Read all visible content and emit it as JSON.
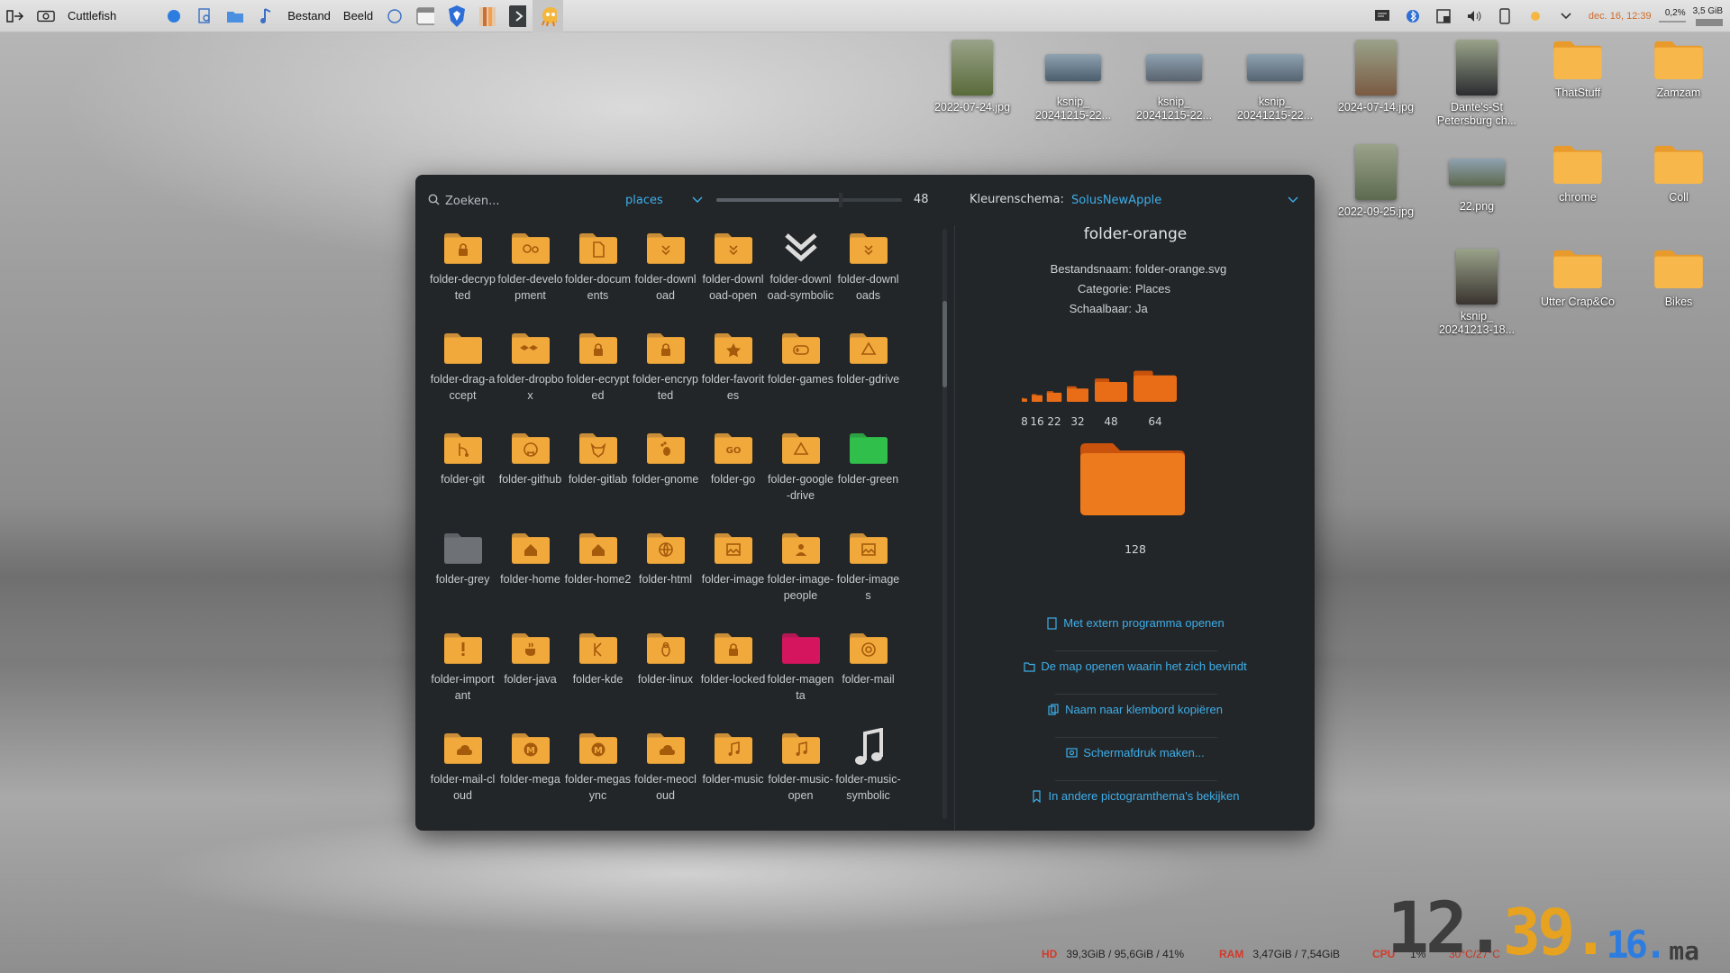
{
  "panel": {
    "app_name": "Cuttlefish",
    "menu": [
      "Bestand",
      "Beeld"
    ],
    "clock_small": "dec. 16, 12:39",
    "cpu_mini": "0,2%",
    "ram_mini": "3,5 GiB"
  },
  "desktop": {
    "row1": [
      "2022-07-24.jpg",
      "ksnip_\n20241215-22...",
      "ksnip_\n20241215-22...",
      "ksnip_\n20241215-22...",
      "2024-07-14.jpg",
      "Dante's-St\nPetersburg ch...",
      "ThatStuff",
      "Zamzam"
    ],
    "row2": [
      "2022-09-25.jpg",
      "22.png",
      "chrome",
      "Coll"
    ],
    "row3": [
      "ksnip_\n20241213-18...",
      "Utter Crap&Co",
      "Bikes"
    ]
  },
  "dialog": {
    "search_placeholder": "Zoeken...",
    "category": "places",
    "size_value": "48",
    "size_fraction": 0.67,
    "scheme_label": "Kleurenschema:",
    "scheme_value": "SolusNewApple",
    "icons": [
      {
        "label": "folder-decrypted",
        "glyph": "lock",
        "color": "#f2a93b"
      },
      {
        "label": "folder-development",
        "glyph": "gears",
        "color": "#f2a93b"
      },
      {
        "label": "folder-documents",
        "glyph": "doc",
        "color": "#f2a93b"
      },
      {
        "label": "folder-download",
        "glyph": "down",
        "color": "#f2a93b"
      },
      {
        "label": "folder-download-open",
        "glyph": "down",
        "color": "#f2a93b"
      },
      {
        "label": "folder-download-symbolic",
        "glyph": "chevron",
        "color": "#dddddd"
      },
      {
        "label": "folder-downloads",
        "glyph": "down",
        "color": "#f2a93b"
      },
      {
        "label": "folder-drag-accept",
        "glyph": "open",
        "color": "#f2a93b"
      },
      {
        "label": "folder-dropbox",
        "glyph": "dropbox",
        "color": "#f2a93b"
      },
      {
        "label": "folder-ecrypted",
        "glyph": "lock",
        "color": "#f2a93b"
      },
      {
        "label": "folder-encrypted",
        "glyph": "lock",
        "color": "#f2a93b"
      },
      {
        "label": "folder-favorites",
        "glyph": "star",
        "color": "#f2a93b"
      },
      {
        "label": "folder-games",
        "glyph": "pad",
        "color": "#f2a93b"
      },
      {
        "label": "folder-gdrive",
        "glyph": "drive",
        "color": "#f2a93b"
      },
      {
        "label": "folder-git",
        "glyph": "git",
        "color": "#f2a93b"
      },
      {
        "label": "folder-github",
        "glyph": "github",
        "color": "#f2a93b"
      },
      {
        "label": "folder-gitlab",
        "glyph": "fox",
        "color": "#f2a93b"
      },
      {
        "label": "folder-gnome",
        "glyph": "foot",
        "color": "#f2a93b"
      },
      {
        "label": "folder-go",
        "glyph": "go",
        "color": "#f2a93b"
      },
      {
        "label": "folder-google-drive",
        "glyph": "drive",
        "color": "#f2a93b"
      },
      {
        "label": "folder-green",
        "glyph": "none",
        "color": "#2fbf4a"
      },
      {
        "label": "folder-grey",
        "glyph": "none",
        "color": "#6e7175"
      },
      {
        "label": "folder-home",
        "glyph": "home",
        "color": "#f2a93b"
      },
      {
        "label": "folder-home2",
        "glyph": "home",
        "color": "#f2a93b"
      },
      {
        "label": "folder-html",
        "glyph": "globe",
        "color": "#f2a93b"
      },
      {
        "label": "folder-image",
        "glyph": "pic",
        "color": "#f2a93b"
      },
      {
        "label": "folder-image-people",
        "glyph": "person",
        "color": "#f2a93b"
      },
      {
        "label": "folder-images",
        "glyph": "pic",
        "color": "#f2a93b"
      },
      {
        "label": "folder-important",
        "glyph": "bang",
        "color": "#f2a93b"
      },
      {
        "label": "folder-java",
        "glyph": "cup",
        "color": "#f2a93b"
      },
      {
        "label": "folder-kde",
        "glyph": "kde",
        "color": "#f2a93b"
      },
      {
        "label": "folder-linux",
        "glyph": "tux",
        "color": "#f2a93b"
      },
      {
        "label": "folder-locked",
        "glyph": "lock",
        "color": "#f2a93b"
      },
      {
        "label": "folder-magenta",
        "glyph": "none",
        "color": "#d6155f"
      },
      {
        "label": "folder-mail",
        "glyph": "at",
        "color": "#f2a93b"
      },
      {
        "label": "folder-mail-cloud",
        "glyph": "cloud",
        "color": "#f2a93b"
      },
      {
        "label": "folder-mega",
        "glyph": "m",
        "color": "#f2a93b"
      },
      {
        "label": "folder-megasync",
        "glyph": "m",
        "color": "#f2a93b"
      },
      {
        "label": "folder-meocloud",
        "glyph": "cloud",
        "color": "#f2a93b"
      },
      {
        "label": "folder-music",
        "glyph": "note",
        "color": "#f2a93b"
      },
      {
        "label": "folder-music-open",
        "glyph": "note",
        "color": "#f2a93b"
      },
      {
        "label": "folder-music-symbolic",
        "glyph": "bignote",
        "color": "#dddddd"
      }
    ],
    "detail": {
      "title": "folder-orange",
      "meta": [
        {
          "k": "Bestandsnaam:",
          "v": "folder-orange.svg"
        },
        {
          "k": "Categorie:",
          "v": "Places"
        },
        {
          "k": "Schaalbaar:",
          "v": "Ja"
        }
      ],
      "sizes": [
        "8",
        "16",
        "22",
        "32",
        "48",
        "64"
      ],
      "big_size": "128",
      "accent": "#e86d16",
      "actions": [
        {
          "label": "Met extern programma openen",
          "icon": "file-icon"
        },
        {
          "label": "De map openen waarin het zich bevindt",
          "icon": "folder-icon"
        },
        {
          "label": "Naam naar klembord kopiëren",
          "icon": "copy-icon"
        },
        {
          "label": "Schermafdruk maken...",
          "icon": "screenshot-icon"
        },
        {
          "label": "In andere pictogramthema's bekijken",
          "icon": "theme-icon"
        }
      ]
    }
  },
  "status": {
    "hd_label": "HD",
    "hd_value": "39,3GiB / 95,6GiB / 41%",
    "ram_label": "RAM",
    "ram_value": "3,47GiB / 7,54GiB",
    "cpu_label": "CPU",
    "cpu_value": "1%",
    "temp": "30°C/27°C"
  },
  "bigclock": {
    "h": "12.",
    "m": "39.",
    "s": "16.",
    "d": "ma"
  }
}
